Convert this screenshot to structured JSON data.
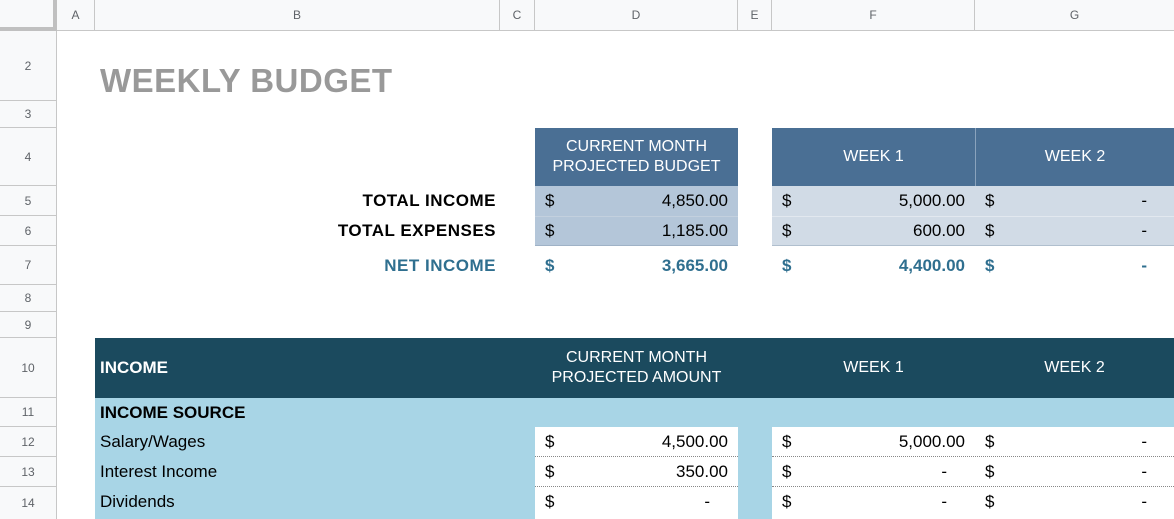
{
  "columns": [
    "A",
    "B",
    "C",
    "D",
    "E",
    "F",
    "G"
  ],
  "rows": [
    "2",
    "3",
    "4",
    "5",
    "6",
    "7",
    "8",
    "9",
    "10",
    "11",
    "12",
    "13",
    "14"
  ],
  "title": "WEEKLY BUDGET",
  "summary": {
    "header_budget": "CURRENT MONTH\nPROJECTED BUDGET",
    "header_week1": "WEEK 1",
    "header_week2": "WEEK 2",
    "rows": [
      {
        "label": "TOTAL INCOME",
        "d_cur": "$",
        "budget": "4,850.00",
        "d_w1": "$",
        "week1": "5,000.00",
        "d_w2": "$",
        "week2": "-"
      },
      {
        "label": "TOTAL EXPENSES",
        "d_cur": "$",
        "budget": "1,185.00",
        "d_w1": "$",
        "week1": "600.00",
        "d_w2": "$",
        "week2": "-"
      },
      {
        "label": "NET INCOME",
        "d_cur": "$",
        "budget": "3,665.00",
        "d_w1": "$",
        "week1": "4,400.00",
        "d_w2": "$",
        "week2": "-"
      }
    ]
  },
  "income": {
    "title": "INCOME",
    "header_amount": "CURRENT MONTH\nPROJECTED AMOUNT",
    "header_week1": "WEEK 1",
    "header_week2": "WEEK 2",
    "section_label": "INCOME SOURCE",
    "rows": [
      {
        "label": "Salary/Wages",
        "d_cur": "$",
        "amount": "4,500.00",
        "d_w1": "$",
        "week1": "5,000.00",
        "d_w2": "$",
        "week2": "-"
      },
      {
        "label": "Interest Income",
        "d_cur": "$",
        "amount": "350.00",
        "d_w1": "$",
        "week1": "-",
        "d_w2": "$",
        "week2": "-"
      },
      {
        "label": "Dividends",
        "d_cur": "$",
        "amount": "-",
        "d_w1": "$",
        "week1": "-",
        "d_w2": "$",
        "week2": "-"
      }
    ]
  },
  "colors": {
    "header_blue": "#4a6f94",
    "budget_cell": "#b4c6d9",
    "week_cell": "#d1dbe6",
    "income_header": "#1b4a5e",
    "income_body": "#a8d5e6",
    "net_text": "#2f6f8f"
  }
}
